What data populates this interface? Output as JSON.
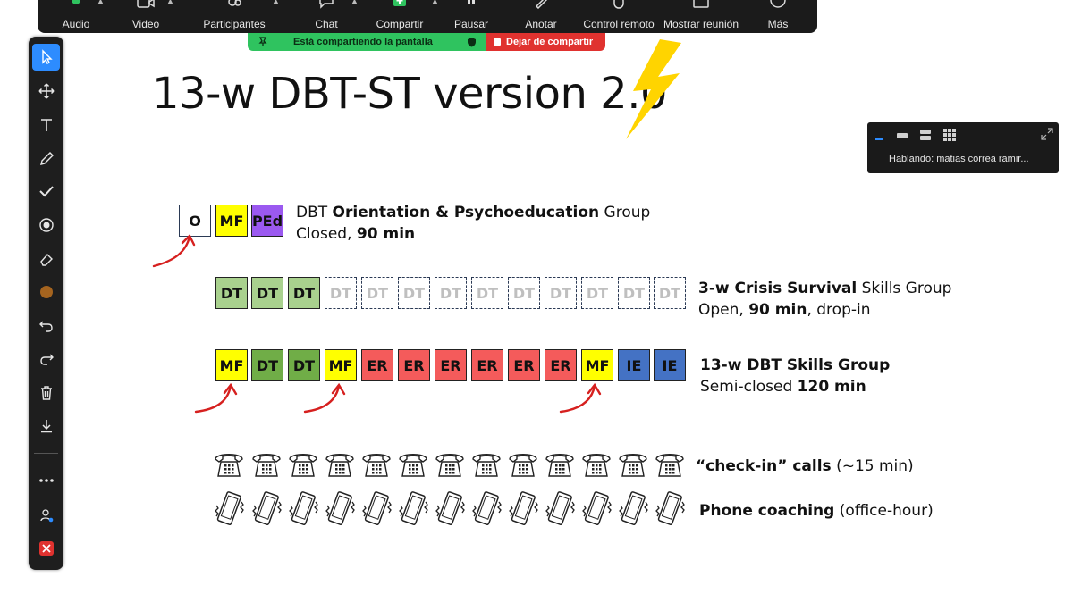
{
  "toolbar": {
    "audio": "Audio",
    "video": "Video",
    "participants": "Participantes",
    "chat": "Chat",
    "share": "Compartir",
    "pause": "Pausar",
    "annotate": "Anotar",
    "remote": "Control remoto",
    "show_meeting": "Mostrar reunión",
    "more": "Más"
  },
  "share_banner": {
    "status": "Está compartiendo la pantalla",
    "stop": "Dejar de compartir"
  },
  "speaker": {
    "text": "Hablando: matias correa ramir..."
  },
  "slide": {
    "title": "13-w DBT-ST version 2.0",
    "row1": {
      "boxes": [
        "O",
        "MF",
        "PEd"
      ],
      "line1_a": "DBT ",
      "line1_b": "Orientation & Psychoeducation",
      "line1_c": " Group",
      "line2_a": "Closed, ",
      "line2_b": "90 min"
    },
    "row2": {
      "boxes": [
        "DT",
        "DT",
        "DT",
        "DT",
        "DT",
        "DT",
        "DT",
        "DT",
        "DT",
        "DT",
        "DT",
        "DT",
        "DT"
      ],
      "line1_a": "3-w Crisis Survival",
      "line1_b": " Skills Group",
      "line2_a": "Open, ",
      "line2_b": "90 min",
      "line2_c": ", drop-in"
    },
    "row3": {
      "boxes": [
        "MF",
        "DT",
        "DT",
        "MF",
        "ER",
        "ER",
        "ER",
        "ER",
        "ER",
        "ER",
        "MF",
        "IE",
        "IE"
      ],
      "line1": "13-w DBT Skills Group",
      "line2_a": "Semi-closed ",
      "line2_b": "120 min"
    },
    "row4": {
      "label_a": "“check-in” calls",
      "label_b": " (~15 min)"
    },
    "row5": {
      "label_a": "Phone coaching",
      "label_b": " (office-hour)"
    }
  },
  "colors": {
    "yellow": "#ffff00",
    "purple": "#9b59f0",
    "green": "#a9d18e",
    "green_dark": "#70ad47",
    "red": "#f45b5b",
    "blue": "#4472c4",
    "share_green": "#2fc35f",
    "share_red": "#e0322f"
  }
}
